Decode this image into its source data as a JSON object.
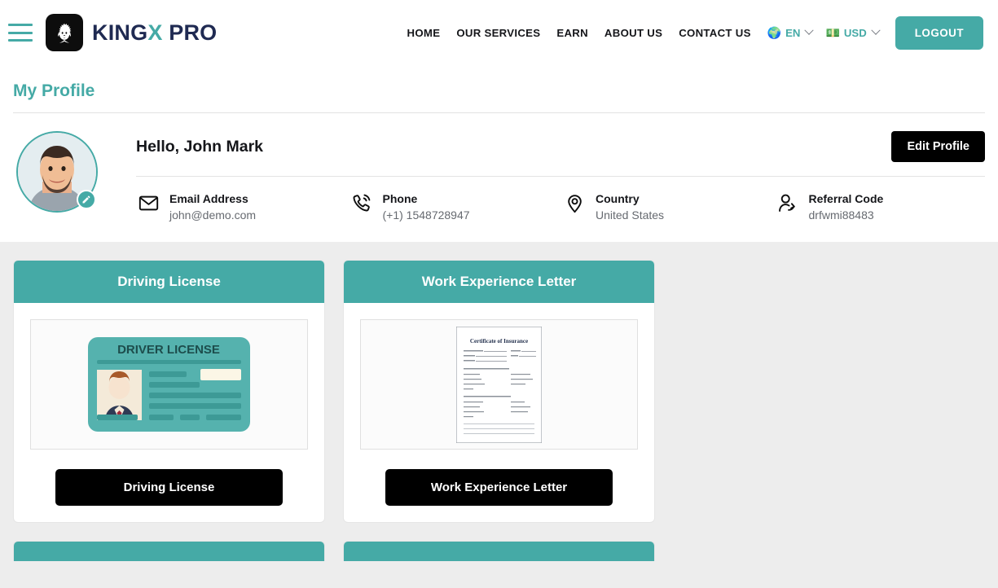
{
  "header": {
    "menu_icon": "hamburger-icon",
    "logo_icon": "lion-head-logo-icon",
    "brand_part1": "KING",
    "brand_accent": "X",
    "brand_part2": " PRO",
    "nav": [
      {
        "label": "HOME"
      },
      {
        "label": "OUR SERVICES"
      },
      {
        "label": "EARN"
      },
      {
        "label": "ABOUT US"
      },
      {
        "label": "CONTACT US"
      }
    ],
    "language": {
      "emoji": "🌍",
      "label": "EN"
    },
    "currency": {
      "emoji": "💵",
      "label": "USD"
    },
    "logout_label": "LOGOUT"
  },
  "page": {
    "title": "My Profile"
  },
  "profile": {
    "avatar_alt": "user-avatar",
    "edit_badge_icon": "pencil-icon",
    "greeting": "Hello, John Mark",
    "edit_profile_label": "Edit Profile",
    "info": [
      {
        "icon": "envelope-icon",
        "label": "Email Address",
        "value": "john@demo.com"
      },
      {
        "icon": "phone-icon",
        "label": "Phone",
        "value": "(+1) 1548728947"
      },
      {
        "icon": "location-pin-icon",
        "label": "Country",
        "value": "United States"
      },
      {
        "icon": "user-referral-icon",
        "label": "Referral Code",
        "value": "drfwmi88483"
      }
    ]
  },
  "documents": [
    {
      "title": "Driving License",
      "button_label": "Driving License",
      "thumb_type": "driver-license-card",
      "thumb_text": "DRIVER LICENSE"
    },
    {
      "title": "Work Experience Letter",
      "button_label": "Work Experience Letter",
      "thumb_type": "certificate-document",
      "thumb_text": "Certificate of Insurance"
    }
  ],
  "colors": {
    "accent_teal": "#45aaa6",
    "brand_navy": "#1f2a52",
    "button_black": "#000000",
    "page_background": "#ededed"
  }
}
